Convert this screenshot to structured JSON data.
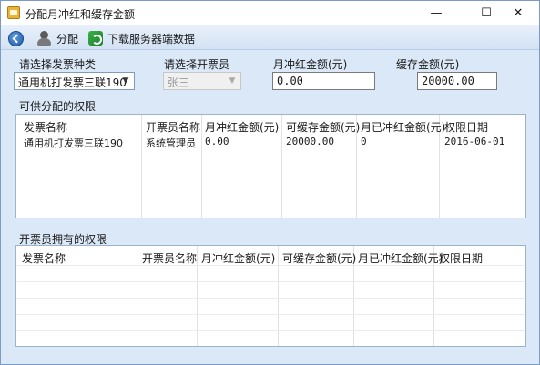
{
  "window": {
    "title": "分配月冲红和缓存金额",
    "controls": {
      "minimize": "—",
      "maximize": "☐",
      "close": "✕"
    }
  },
  "toolbar": {
    "back_icon": "back-arrow-icon",
    "assign_label": "分配",
    "download_label": "下载服务器端数据"
  },
  "form": {
    "invoice_type": {
      "label": "请选择发票种类",
      "value": "通用机打发票三联190"
    },
    "issuer": {
      "label": "请选择开票员",
      "value": "张三"
    },
    "monthly_red": {
      "label": "月冲红金额(元)",
      "value": "0.00"
    },
    "cache_amount": {
      "label": "缓存金额(元)",
      "value": "20000.00"
    }
  },
  "available_permissions": {
    "title": "可供分配的权限",
    "columns": [
      "发票名称",
      "开票员名称",
      "月冲红金额(元)",
      "可缓存金额(元)",
      "月已冲红金额(元)",
      "权限日期"
    ],
    "rows": [
      [
        "通用机打发票三联190",
        "系统管理员",
        "0.00",
        "20000.00",
        "0",
        "2016-06-01"
      ]
    ]
  },
  "issuer_permissions": {
    "title": "开票员拥有的权限",
    "columns": [
      "发票名称",
      "开票员名称",
      "月冲红金额(元)",
      "可缓存金额(元)",
      "月已冲红金额(元)",
      "权限日期"
    ],
    "rows": []
  }
}
